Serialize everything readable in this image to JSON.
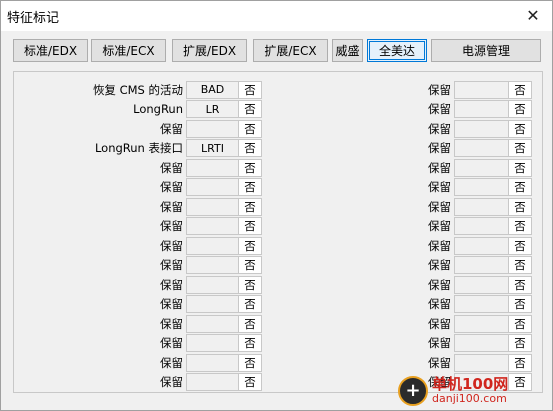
{
  "window": {
    "title": "特征标记",
    "close_glyph": "✕"
  },
  "tabs": [
    {
      "label": "标准/EDX",
      "active": false
    },
    {
      "label": "标准/ECX",
      "active": false
    },
    {
      "label": "扩展/EDX",
      "active": false
    },
    {
      "label": "扩展/ECX",
      "active": false
    },
    {
      "label": "威盛",
      "active": false
    },
    {
      "label": "全美达",
      "active": true
    },
    {
      "label": "电源管理",
      "active": false
    }
  ],
  "left_rows": [
    {
      "label": "恢复 CMS 的活动",
      "value": "BAD",
      "flag": "否"
    },
    {
      "label": "LongRun",
      "value": "LR",
      "flag": "否"
    },
    {
      "label": "保留",
      "value": "",
      "flag": "否"
    },
    {
      "label": "LongRun 表接口",
      "value": "LRTI",
      "flag": "否"
    },
    {
      "label": "保留",
      "value": "",
      "flag": "否"
    },
    {
      "label": "保留",
      "value": "",
      "flag": "否"
    },
    {
      "label": "保留",
      "value": "",
      "flag": "否"
    },
    {
      "label": "保留",
      "value": "",
      "flag": "否"
    },
    {
      "label": "保留",
      "value": "",
      "flag": "否"
    },
    {
      "label": "保留",
      "value": "",
      "flag": "否"
    },
    {
      "label": "保留",
      "value": "",
      "flag": "否"
    },
    {
      "label": "保留",
      "value": "",
      "flag": "否"
    },
    {
      "label": "保留",
      "value": "",
      "flag": "否"
    },
    {
      "label": "保留",
      "value": "",
      "flag": "否"
    },
    {
      "label": "保留",
      "value": "",
      "flag": "否"
    },
    {
      "label": "保留",
      "value": "",
      "flag": "否"
    }
  ],
  "right_rows": [
    {
      "label": "保留",
      "value": "",
      "flag": "否"
    },
    {
      "label": "保留",
      "value": "",
      "flag": "否"
    },
    {
      "label": "保留",
      "value": "",
      "flag": "否"
    },
    {
      "label": "保留",
      "value": "",
      "flag": "否"
    },
    {
      "label": "保留",
      "value": "",
      "flag": "否"
    },
    {
      "label": "保留",
      "value": "",
      "flag": "否"
    },
    {
      "label": "保留",
      "value": "",
      "flag": "否"
    },
    {
      "label": "保留",
      "value": "",
      "flag": "否"
    },
    {
      "label": "保留",
      "value": "",
      "flag": "否"
    },
    {
      "label": "保留",
      "value": "",
      "flag": "否"
    },
    {
      "label": "保留",
      "value": "",
      "flag": "否"
    },
    {
      "label": "保留",
      "value": "",
      "flag": "否"
    },
    {
      "label": "保留",
      "value": "",
      "flag": "否"
    },
    {
      "label": "保留",
      "value": "",
      "flag": "否"
    },
    {
      "label": "保留",
      "value": "",
      "flag": "否"
    },
    {
      "label": "保留",
      "value": "",
      "flag": "否"
    }
  ],
  "watermark": {
    "logo_glyph": "+",
    "text": "单机100网",
    "url": "danji100.com"
  }
}
